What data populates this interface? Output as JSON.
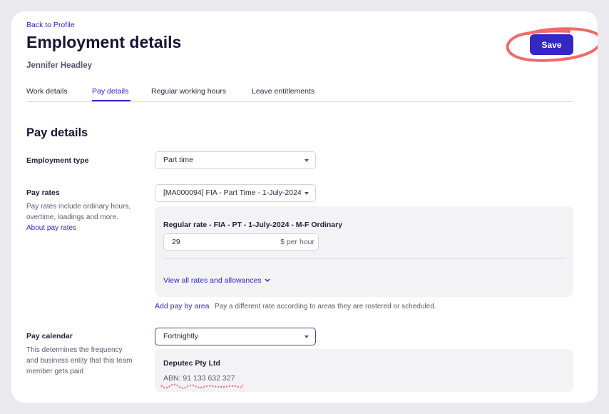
{
  "header": {
    "back_link": "Back to Profile",
    "title": "Employment details",
    "person_name": "Jennifer Headley",
    "save_label": "Save"
  },
  "tabs": [
    {
      "label": "Work details",
      "active": false
    },
    {
      "label": "Pay details",
      "active": true
    },
    {
      "label": "Regular working hours",
      "active": false
    },
    {
      "label": "Leave entitlements",
      "active": false
    }
  ],
  "section": {
    "title": "Pay details"
  },
  "employment_type": {
    "label": "Employment type",
    "value": "Part time"
  },
  "pay_rates": {
    "label": "Pay rates",
    "help": "Pay rates include ordinary hours, overtime, loadings and more.",
    "help_link": "About pay rates",
    "select_value": "[MA000094] FIA - Part Time - 1-July-2024",
    "rate_title": "Regular rate - FIA - PT - 1-July-2024 - M-F Ordinary",
    "rate_value": "29",
    "rate_unit": "$ per hour",
    "view_all_link": "View all rates and allowances",
    "add_pay_link": "Add pay by area",
    "add_pay_note": "Pay a different rate according to areas they are rostered or scheduled."
  },
  "pay_calendar": {
    "label": "Pay calendar",
    "help": "This determines the frequency and business entity that this team member gets paid",
    "value": "Fortnightly",
    "entity_name": "Deputec Pty Ltd",
    "abn": "ABN: 91 133 632 327"
  },
  "colors": {
    "accent": "#3527c2",
    "annotation": "#f06a6a",
    "background": "#e9e9ee"
  },
  "icons": {
    "caret": "chevron-down-icon"
  }
}
